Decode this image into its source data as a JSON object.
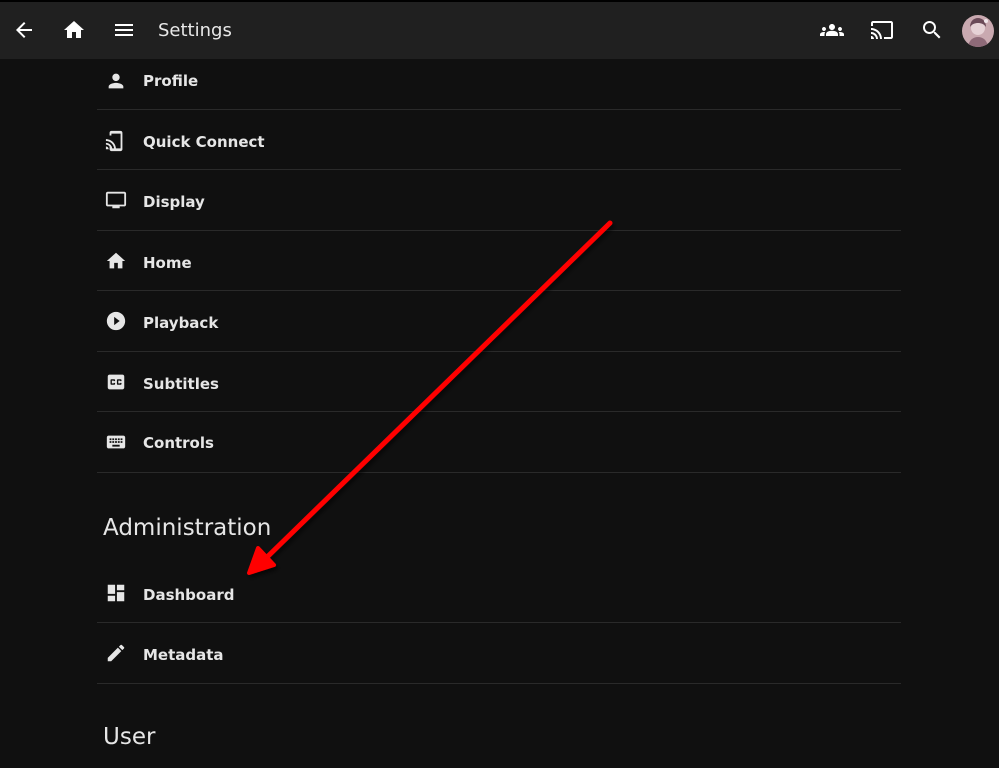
{
  "header": {
    "title": "Settings",
    "buttons": [
      {
        "name": "back-button",
        "icon": "arrow-back-icon"
      },
      {
        "name": "home-button",
        "icon": "home-icon"
      },
      {
        "name": "menu-button",
        "icon": "menu-icon"
      },
      {
        "name": "sync-play-button",
        "icon": "group-icon"
      },
      {
        "name": "cast-button",
        "icon": "cast-icon"
      },
      {
        "name": "search-button",
        "icon": "search-icon"
      }
    ]
  },
  "user_settings": {
    "items": [
      {
        "label": "Profile",
        "icon": "person-icon"
      },
      {
        "label": "Quick Connect",
        "icon": "phonelink-icon"
      },
      {
        "label": "Display",
        "icon": "monitor-icon"
      },
      {
        "label": "Home",
        "icon": "home-icon"
      },
      {
        "label": "Playback",
        "icon": "play-circle-icon"
      },
      {
        "label": "Subtitles",
        "icon": "closed-caption-icon"
      },
      {
        "label": "Controls",
        "icon": "keyboard-icon"
      }
    ]
  },
  "administration": {
    "heading": "Administration",
    "items": [
      {
        "label": "Dashboard",
        "icon": "dashboard-icon"
      },
      {
        "label": "Metadata",
        "icon": "edit-pencil-icon"
      }
    ]
  },
  "user": {
    "heading": "User"
  },
  "colors": {
    "background": "#101010",
    "topbar": "#202020",
    "divider": "#2a2a2a",
    "annotation_arrow": "#ff0000"
  }
}
